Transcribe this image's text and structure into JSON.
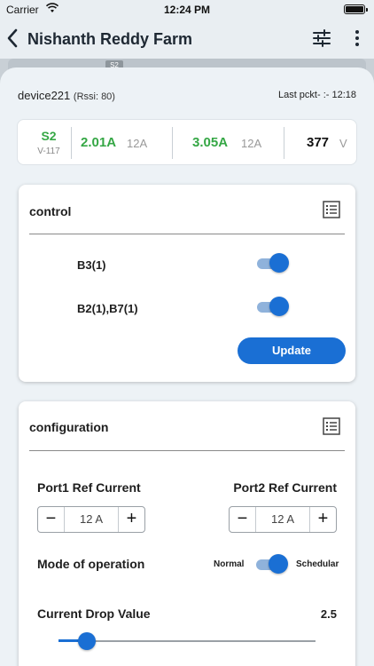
{
  "status_bar": {
    "carrier": "Carrier",
    "time": "12:24 PM",
    "wifi_icon": "wifi-icon",
    "battery_icon": "battery-icon"
  },
  "nav": {
    "title": "Nishanth Reddy Farm",
    "back_icon": "chevron-left-icon",
    "filter_icon": "sliders-icon",
    "more_icon": "more-vertical-icon"
  },
  "backdrop": {
    "badge": "S2"
  },
  "device": {
    "name": "device221",
    "rssi": "(Rssi: 80)",
    "last_packet": "Last pckt-  :- 12:18"
  },
  "stats": {
    "switch_label": "S2",
    "switch_sub": "V-117",
    "port1_current": "2.01A",
    "port1_max": "12A",
    "port2_current": "3.05A",
    "port2_max": "12A",
    "voltage": "377",
    "voltage_unit": "V"
  },
  "control": {
    "title": "control",
    "icon": "list-icon",
    "items": [
      {
        "label": "B3(1)",
        "on": true
      },
      {
        "label": "B2(1),B7(1)",
        "on": true
      }
    ],
    "update_label": "Update"
  },
  "configuration": {
    "title": "configuration",
    "icon": "list-icon",
    "port1_label": "Port1 Ref Current",
    "port1_value": "12 A",
    "port2_label": "Port2 Ref Current",
    "port2_value": "12 A",
    "mode_label": "Mode of operation",
    "mode_left": "Normal",
    "mode_right": "Schedular",
    "mode_on": true,
    "drop_label": "Current Drop Value",
    "drop_value": "2.5",
    "slider_fraction": 0.11
  },
  "colors": {
    "accent": "#1a6fd4",
    "green": "#35a745",
    "sheet_bg": "#edf2f6"
  }
}
